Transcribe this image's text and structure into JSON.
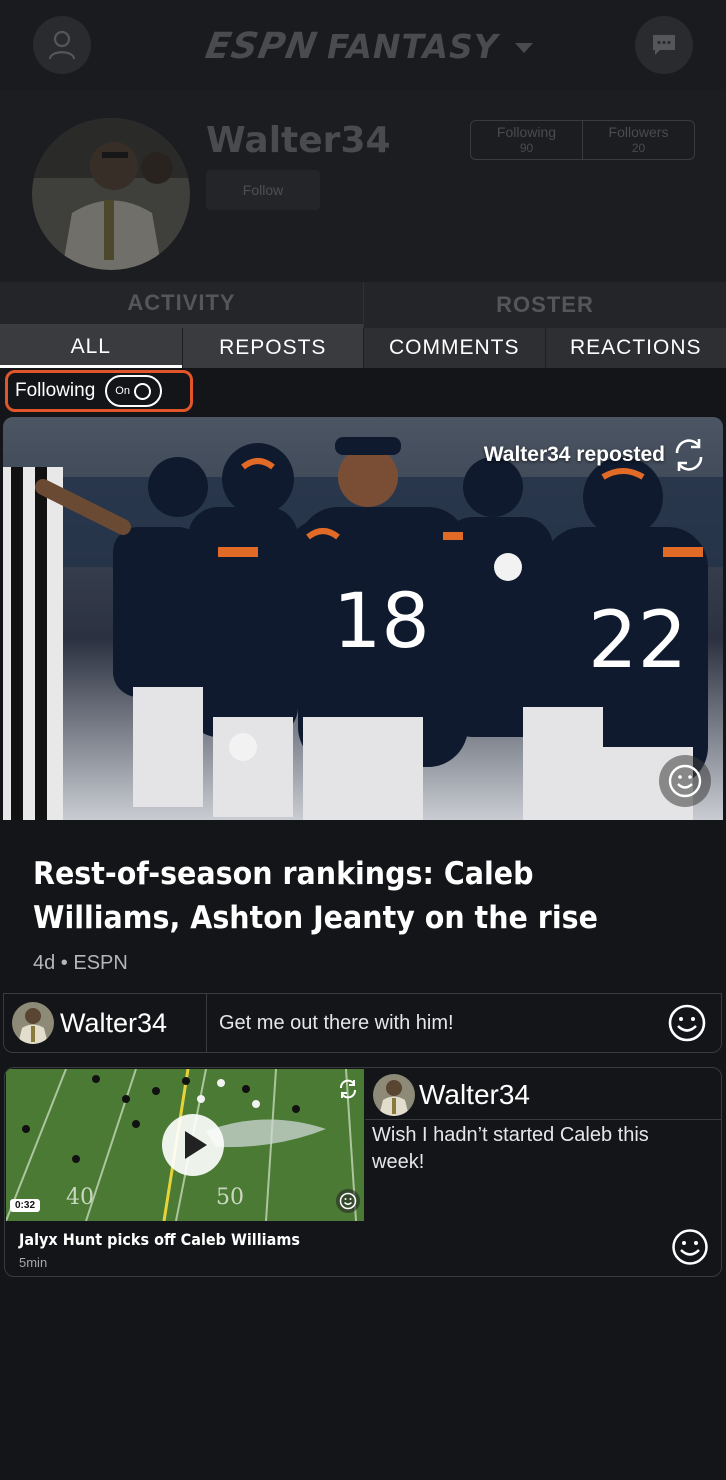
{
  "header": {
    "brand_left": "ESPN",
    "brand_right": "FANTASY",
    "profile_icon": "user-icon",
    "messages_icon": "chat-bubble-icon"
  },
  "profile": {
    "username": "Walter34",
    "follow_label": "Follow",
    "following_label": "Following",
    "following_count": "90",
    "followers_label": "Followers",
    "followers_count": "20"
  },
  "main_tabs": [
    "ACTIVITY",
    "ROSTER"
  ],
  "sub_tabs": [
    "ALL",
    "REPOSTS",
    "COMMENTS",
    "REACTIONS"
  ],
  "filter": {
    "label": "Following",
    "toggle_state": "On",
    "highlight_color": "#e0562a"
  },
  "hero": {
    "repost_text": "Walter34 reposted",
    "title": "Rest-of-season rankings: Caleb Williams, Ashton Jeanty on the rise",
    "meta": "4d • ESPN"
  },
  "comment": {
    "user": "Walter34",
    "text": "Get me out there with him!"
  },
  "video": {
    "duration": "0:32",
    "caption": "Jalyx Hunt picks off Caleb Williams",
    "age": "5min",
    "user": "Walter34",
    "text": "Wish I hadn’t started Caleb this week!"
  }
}
